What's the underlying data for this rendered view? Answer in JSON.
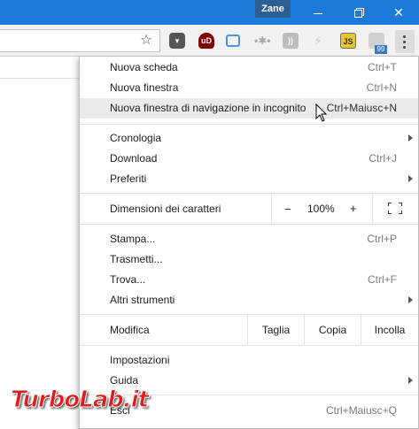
{
  "window": {
    "profile_name": "Zane",
    "controls": [
      "minimize",
      "maximize",
      "close"
    ]
  },
  "toolbar": {
    "bookmark_icon": "star-icon",
    "extensions": [
      {
        "name": "pocket-extension-icon"
      },
      {
        "name": "ublock-extension-icon",
        "text": "uD"
      },
      {
        "name": "screen-capture-extension-icon"
      },
      {
        "name": "dots-extension-icon",
        "text": "•✱•"
      },
      {
        "name": "rss-extension-icon"
      },
      {
        "name": "bolt-extension-icon",
        "text": "⚡"
      },
      {
        "name": "js-extension-icon",
        "text": "JS"
      },
      {
        "name": "tag-extension-icon",
        "badge": "99"
      }
    ],
    "menu_icon": "vertical-dots-icon"
  },
  "menu": {
    "new_tab": {
      "label": "Nuova scheda",
      "shortcut": "Ctrl+T"
    },
    "new_window": {
      "label": "Nuova finestra",
      "shortcut": "Ctrl+N"
    },
    "incognito": {
      "label": "Nuova finestra di navigazione in incognito",
      "shortcut": "Ctrl+Maiusc+N"
    },
    "history": {
      "label": "Cronologia"
    },
    "downloads": {
      "label": "Download",
      "shortcut": "Ctrl+J"
    },
    "bookmarks": {
      "label": "Preferiti"
    },
    "zoom": {
      "label": "Dimensioni dei caratteri",
      "minus": "−",
      "value": "100%",
      "plus": "+"
    },
    "print": {
      "label": "Stampa...",
      "shortcut": "Ctrl+P"
    },
    "cast": {
      "label": "Trasmetti..."
    },
    "find": {
      "label": "Trova...",
      "shortcut": "Ctrl+F"
    },
    "more_tools": {
      "label": "Altri strumenti"
    },
    "edit": {
      "label": "Modifica",
      "cut": "Taglia",
      "copy": "Copia",
      "paste": "Incolla"
    },
    "settings": {
      "label": "Impostazioni"
    },
    "help": {
      "label": "Guida"
    },
    "exit": {
      "label": "Esci",
      "shortcut": "Ctrl+Maiusc+Q"
    }
  },
  "watermark": {
    "text": "TurboLab.it"
  },
  "colors": {
    "titlebar": "#1c7ad9",
    "menu_highlight": "#ebebeb",
    "watermark": "#e01d1d"
  }
}
